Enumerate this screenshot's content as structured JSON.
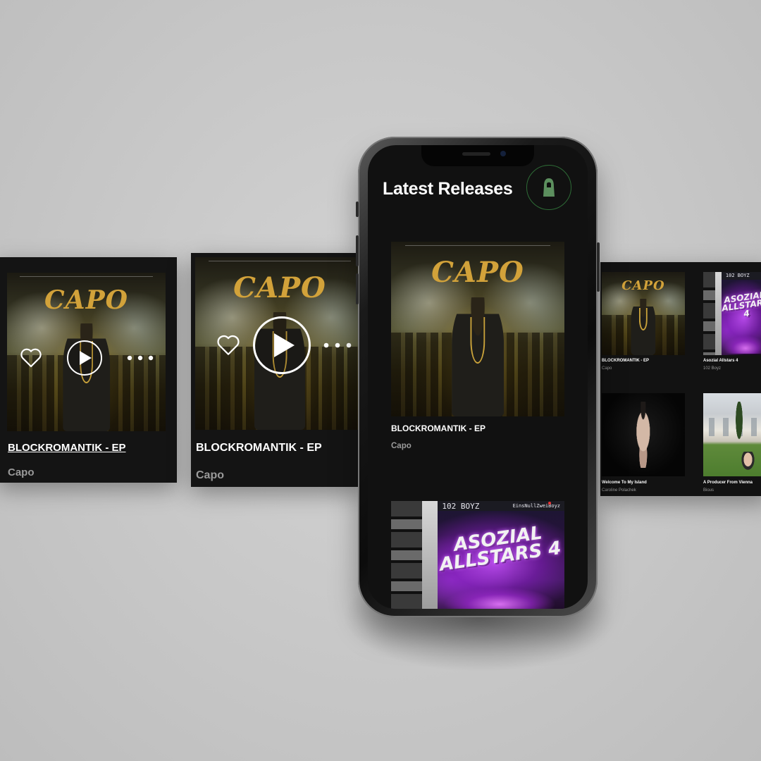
{
  "screen": {
    "title": "Latest Releases",
    "profile_icon": "hooded-figure-icon",
    "accent_color": "#2e6b36"
  },
  "releases": [
    {
      "title": "BLOCKROMANTIK - EP",
      "artist": "Capo",
      "art_text": "CAPO"
    },
    {
      "title": "Asozial Allstars 4",
      "artist": "102 Boyz",
      "art_text": "ASOZIAL ALLSTARS 4",
      "art_header_left": "102 BOYZ",
      "art_header_right": "EinsNullZweiBoyz"
    },
    {
      "title": "Welcome To My Island",
      "artist": "Caroline Polachek"
    },
    {
      "title": "A Producer From Vienna",
      "artist": "Bious"
    }
  ],
  "hover_card": {
    "icons": [
      "heart-icon",
      "play-icon",
      "more-dots-icon"
    ]
  }
}
